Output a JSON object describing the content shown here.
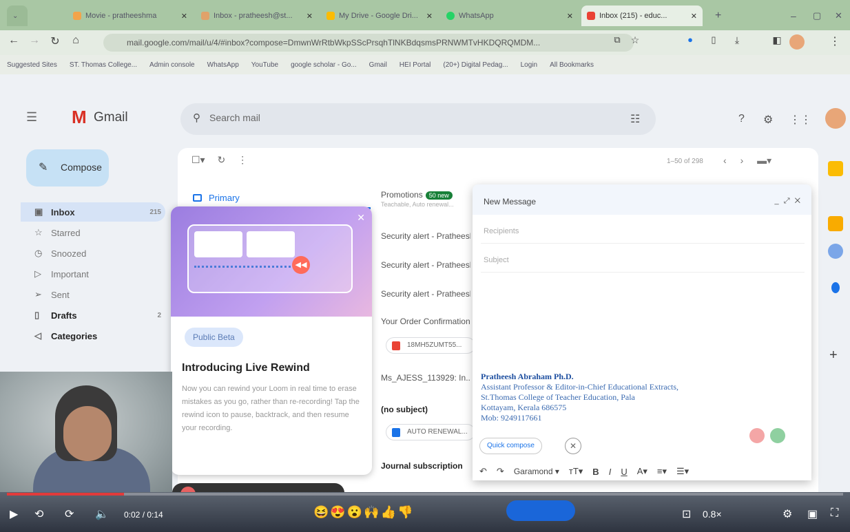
{
  "browser": {
    "tabs": [
      {
        "label": "Movie - pratheeshma"
      },
      {
        "label": "Inbox - pratheesh@st..."
      },
      {
        "label": "My Drive - Google Dri..."
      },
      {
        "label": "WhatsApp"
      },
      {
        "label": "Inbox (215) - educ..."
      }
    ],
    "url": "mail.google.com/mail/u/4/#inbox?compose=DmwnWrRtbWkpSScPrsqhTlNKBdqsmsPRNWMTvHKDQRQMDM...",
    "bookmarks": [
      "Suggested Sites",
      "ST. Thomas College...",
      "Admin console",
      "WhatsApp",
      "YouTube",
      "google scholar - Go...",
      "Gmail",
      "HEI Portal",
      "(20+) Digital Pedag...",
      "Login",
      "All Bookmarks"
    ]
  },
  "gmail": {
    "logo": "Gmail",
    "search_placeholder": "Search mail",
    "compose_label": "Compose",
    "nav": [
      {
        "label": "Inbox",
        "count": "215"
      },
      {
        "label": "Starred",
        "count": ""
      },
      {
        "label": "Snoozed",
        "count": ""
      },
      {
        "label": "Important",
        "count": ""
      },
      {
        "label": "Sent",
        "count": ""
      },
      {
        "label": "Drafts",
        "count": "2"
      },
      {
        "label": "Categories",
        "count": ""
      }
    ],
    "pager": "1–50 of 298",
    "tab_primary": "Primary",
    "tab_promotions": "Promotions",
    "promotions_badge": "50 new",
    "promotions_sub": "Teachable, Auto renewal...",
    "mails": [
      "Security alert - Pratheesh",
      "Security alert - Pratheesh",
      "Security alert - Pratheesh",
      "Your Order Confirmation",
      "Ms_AJESS_113929: In...",
      "(no subject)",
      "Journal subscription"
    ],
    "chips": [
      "18MH5ZUMT55...",
      "AUTO RENEWAL..."
    ]
  },
  "loom_card": {
    "badge": "Public Beta",
    "title": "Introducing Live Rewind",
    "body": "Now you can rewind your Loom in real time to erase mistakes as you go, rather than re-recording! Tap the rewind icon to pause, backtrack, and then resume your recording."
  },
  "compose_window": {
    "title": "New Message",
    "recipients_placeholder": "Recipients",
    "subject_placeholder": "Subject",
    "signature": {
      "name": "Pratheesh Abraham Ph.D.",
      "line1": "Assistant Professor & Editor-in-Chief Educational Extracts,",
      "line2": "St.Thomas College of Teacher Education, Pala",
      "line3": "Kottayam, Kerala 686575",
      "line4": "Mob: 9249117661"
    },
    "quick_compose": "Quick compose",
    "font": "Garamond"
  },
  "video": {
    "time": "0:02 / 0:14",
    "speed": "0.8×",
    "progress_fraction": 0.14
  }
}
